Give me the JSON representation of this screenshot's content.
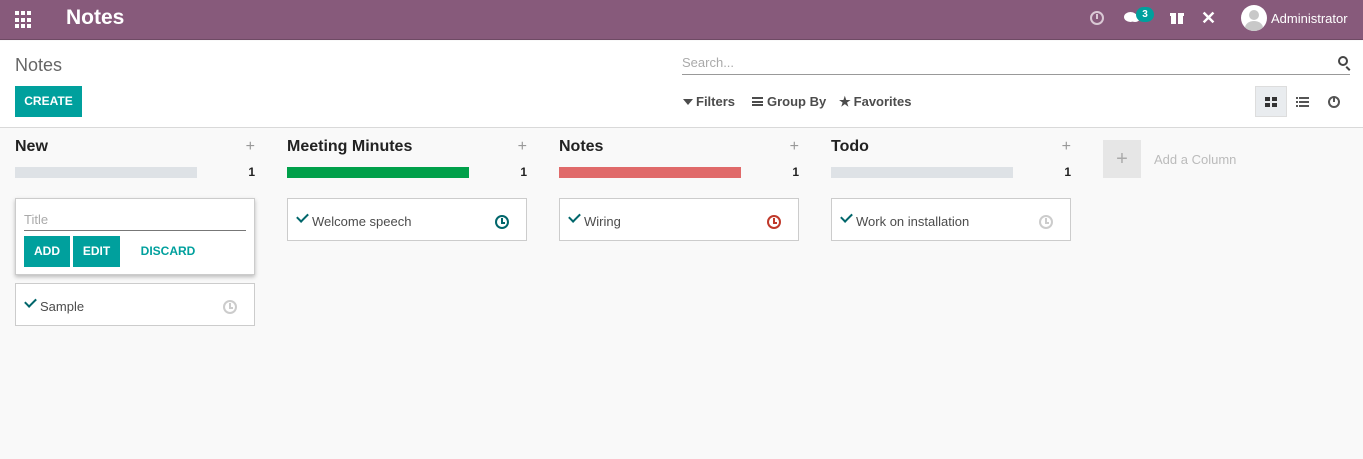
{
  "navbar": {
    "app_title": "Notes",
    "message_count": "3",
    "user_name": "Administrator",
    "icons": [
      "apps-icon",
      "clock-icon",
      "chat-icon",
      "gift-icon",
      "tools-icon",
      "avatar"
    ],
    "bg_color": "#875a7b"
  },
  "control_panel": {
    "breadcrumb": "Notes",
    "create_label": "CREATE",
    "search_placeholder": "Search...",
    "filters_label": "Filters",
    "group_by_label": "Group By",
    "favorites_label": "Favorites",
    "views": [
      "kanban",
      "list",
      "activity"
    ],
    "active_view": "kanban"
  },
  "columns": [
    {
      "title": "New",
      "count": "1",
      "progress_color": "#dee2e6",
      "progress_fraction": 0
    },
    {
      "title": "Meeting Minutes",
      "count": "1",
      "progress_color": "#00a04a",
      "progress_fraction": 1
    },
    {
      "title": "Notes",
      "count": "1",
      "progress_color": "#e06a6a",
      "progress_fraction": 1
    },
    {
      "title": "Todo",
      "count": "1",
      "progress_color": "#dee2e6",
      "progress_fraction": 0
    }
  ],
  "quick_create": {
    "title_placeholder": "Title",
    "add_label": "ADD",
    "edit_label": "EDIT",
    "discard_label": "DISCARD"
  },
  "cards": [
    {
      "column": "New",
      "title": "Sample",
      "activity_color": "#cccccc"
    },
    {
      "column": "Meeting Minutes",
      "title": "Welcome speech",
      "activity_color": "#01666b"
    },
    {
      "column": "Notes",
      "title": "Wiring",
      "activity_color": "#c0392b"
    },
    {
      "column": "Todo",
      "title": "Work on installation",
      "activity_color": "#cccccc"
    }
  ],
  "add_column_label": "Add a Column",
  "accent_color": "#00a09d"
}
